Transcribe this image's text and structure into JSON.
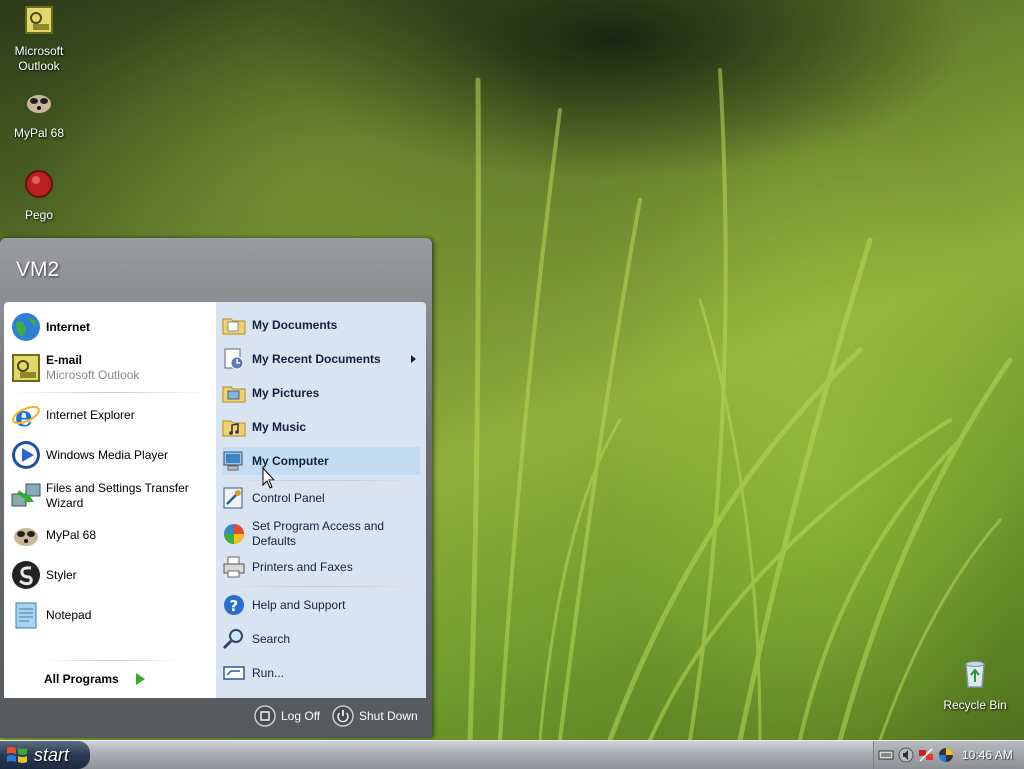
{
  "desktop": {
    "icons": [
      {
        "label_lines": [
          "Microsoft",
          "Outlook"
        ],
        "icon": "outlook-icon"
      },
      {
        "label_lines": [
          "MyPal 68"
        ],
        "icon": "mypal-icon"
      },
      {
        "label_lines": [
          "Pego"
        ],
        "icon": "pego-icon"
      },
      {
        "label_lines": [
          "Recycle Bin"
        ],
        "icon": "recycle-bin-icon"
      }
    ]
  },
  "start_menu": {
    "user": "VM2",
    "left": {
      "pinned": [
        {
          "label": "Internet",
          "sub": "",
          "icon": "internet-globe-icon"
        },
        {
          "label": "E-mail",
          "sub": "Microsoft Outlook",
          "icon": "outlook-icon"
        }
      ],
      "recent": [
        {
          "label": "Internet Explorer",
          "icon": "internet-explorer-icon"
        },
        {
          "label": "Windows Media Player",
          "icon": "media-player-icon"
        },
        {
          "label_lines": [
            "Files and Settings Transfer",
            "Wizard"
          ],
          "icon": "transfer-wizard-icon"
        },
        {
          "label": "MyPal 68",
          "icon": "mypal-icon"
        },
        {
          "label": "Styler",
          "icon": "styler-icon"
        },
        {
          "label": "Notepad",
          "icon": "notepad-icon"
        }
      ],
      "all_programs": "All Programs"
    },
    "right": {
      "items": [
        {
          "label": "My Documents",
          "icon": "folder-documents-icon"
        },
        {
          "label": "My Recent Documents",
          "icon": "recent-documents-icon",
          "has_submenu": true
        },
        {
          "label": "My Pictures",
          "icon": "folder-pictures-icon"
        },
        {
          "label": "My Music",
          "icon": "folder-music-icon"
        },
        {
          "label": "My Computer",
          "icon": "computer-icon",
          "highlighted": true
        },
        {
          "label": "Control Panel",
          "icon": "control-panel-icon"
        },
        {
          "label_lines": [
            "Set Program Access and",
            "Defaults"
          ],
          "icon": "program-access-icon"
        },
        {
          "label": "Printers and Faxes",
          "icon": "printer-icon"
        },
        {
          "label": "Help and Support",
          "icon": "help-icon"
        },
        {
          "label": "Search",
          "icon": "search-icon"
        },
        {
          "label": "Run...",
          "icon": "run-icon"
        }
      ]
    },
    "bottom": {
      "log_off": "Log Off",
      "shut_down": "Shut Down"
    }
  },
  "taskbar": {
    "start_label": "start",
    "clock": "10:46 AM",
    "tray_icons": [
      "keyboard-icon",
      "volume-icon",
      "network-icon",
      "security-icon"
    ]
  },
  "colors": {
    "start_button": "#2a3a52",
    "menu_right_bg": "#d9e4f2",
    "highlight": "#c4dcf3"
  }
}
